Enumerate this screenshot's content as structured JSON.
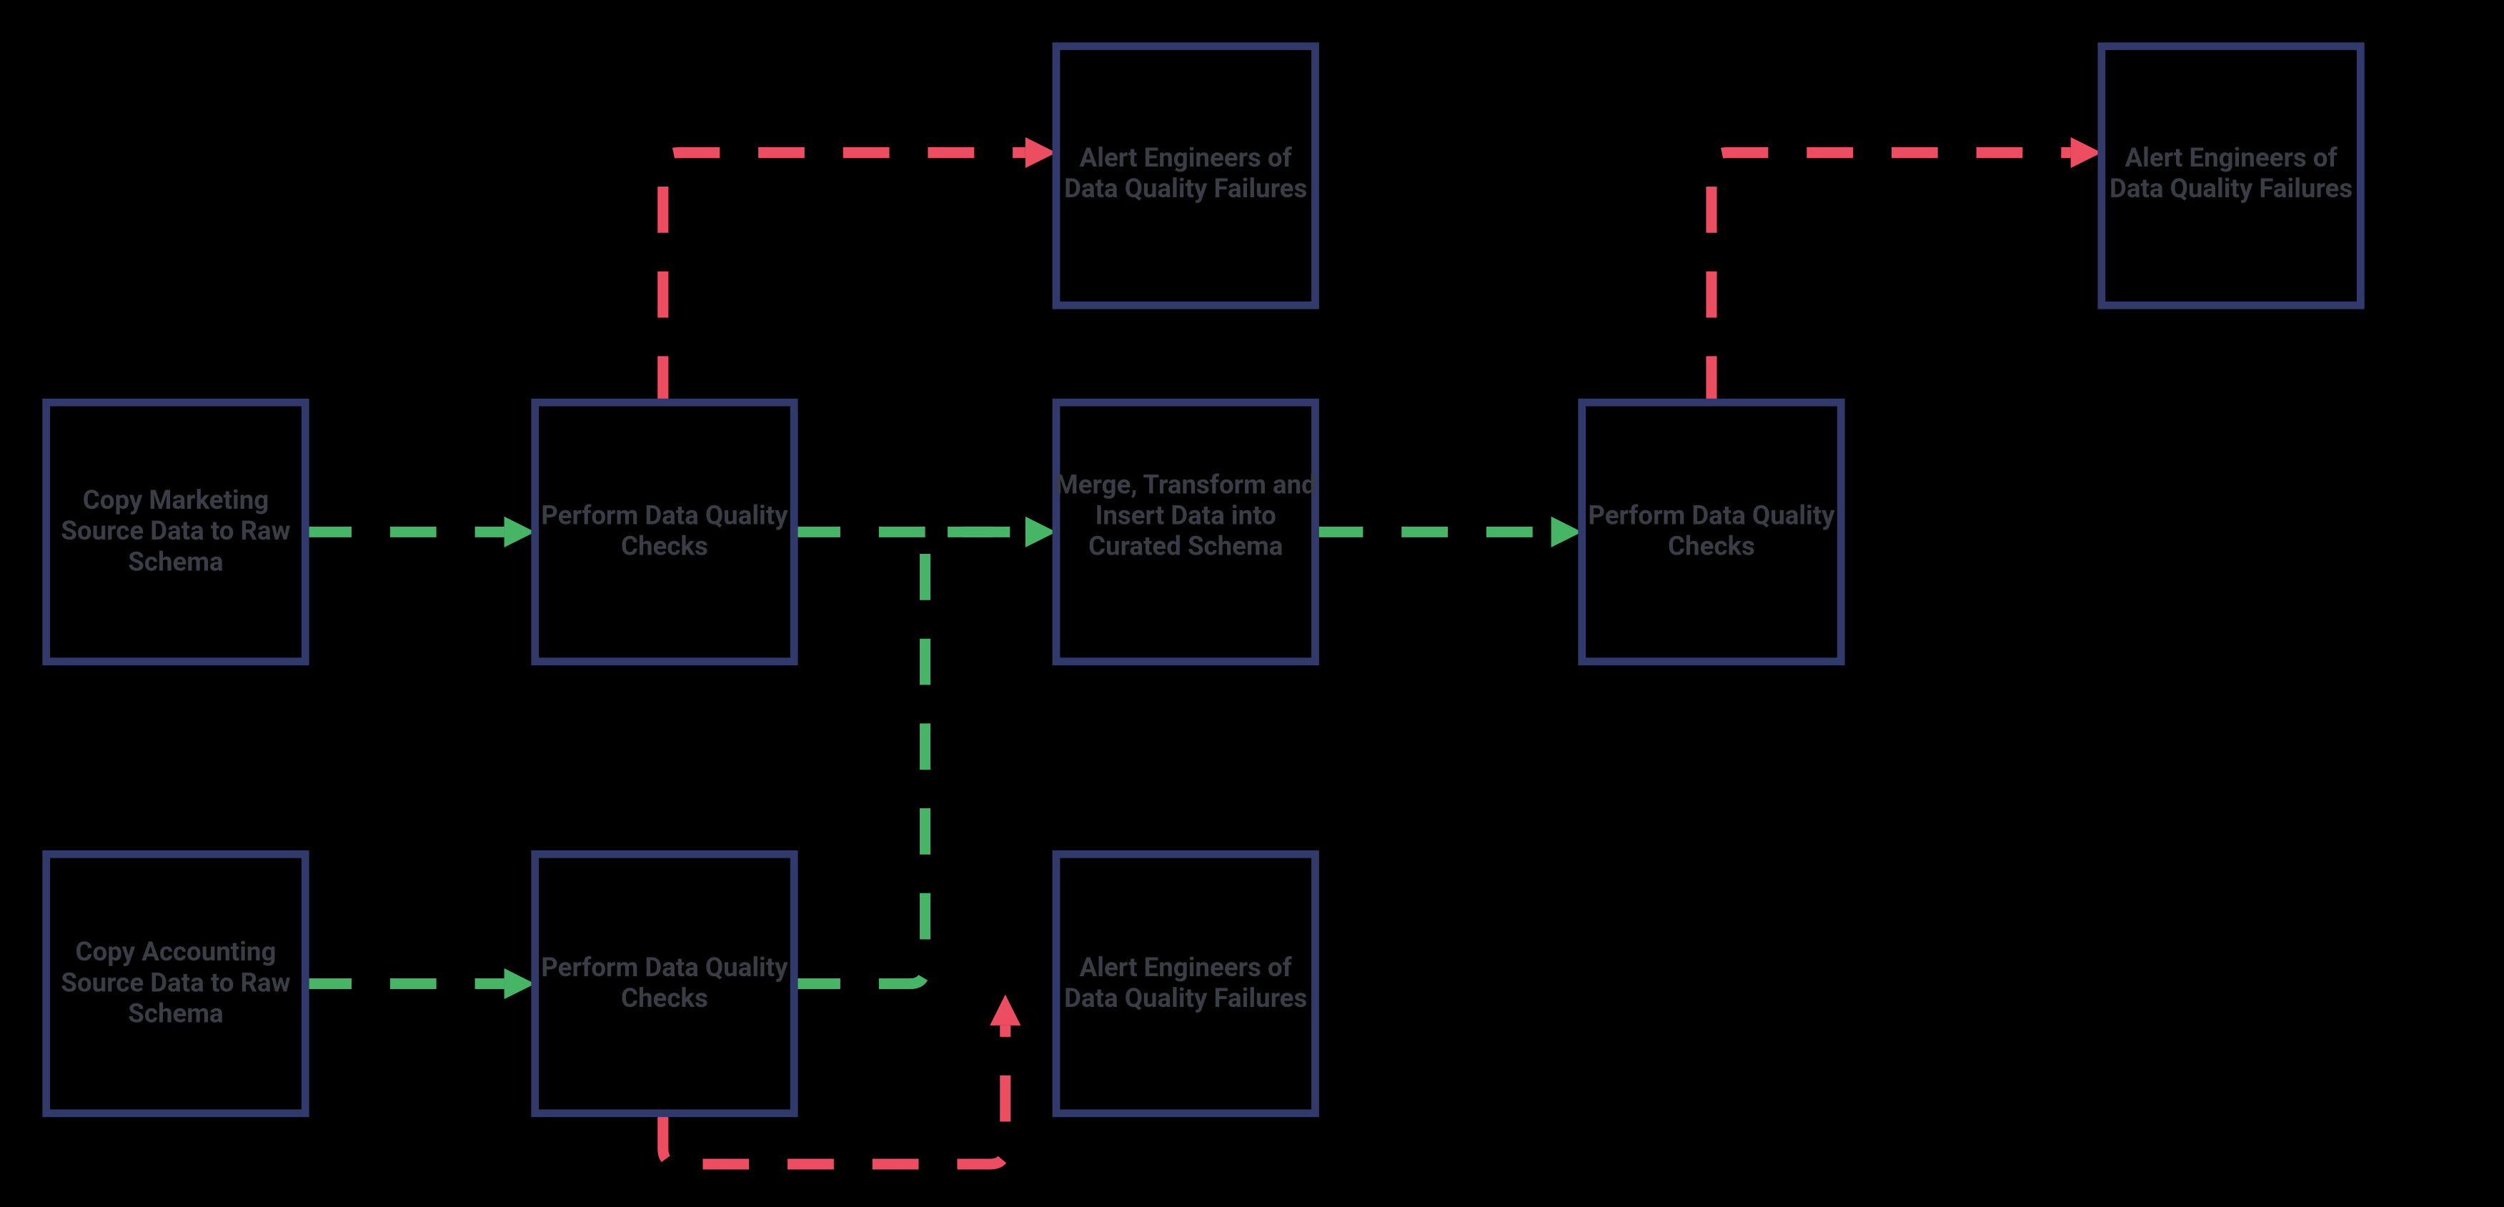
{
  "colors": {
    "background": "#000000",
    "node_border": "#313A6B",
    "node_text": "#3A3C46",
    "edge_success": "#46B565",
    "edge_failure": "#ED4D60"
  },
  "diagram": {
    "nodes": [
      {
        "id": "n1",
        "lines": [
          "Copy Marketing",
          "Source Data to Raw",
          "Schema"
        ]
      },
      {
        "id": "n2",
        "lines": [
          "Copy Accounting",
          "Source Data to Raw",
          "Schema"
        ]
      },
      {
        "id": "n3",
        "lines": [
          "Perform Data Quality",
          "Checks"
        ]
      },
      {
        "id": "n4",
        "lines": [
          "Perform Data Quality",
          "Checks"
        ]
      },
      {
        "id": "n5",
        "lines": [
          "Alert Engineers of",
          "Data Quality Failures"
        ]
      },
      {
        "id": "n6",
        "lines": [
          "Merge, Transform and",
          "Insert Data into",
          "Curated Schema"
        ]
      },
      {
        "id": "n7",
        "lines": [
          "Alert Engineers of",
          "Data Quality Failures"
        ]
      },
      {
        "id": "n8",
        "lines": [
          "Perform Data Quality",
          "Checks"
        ]
      },
      {
        "id": "n9",
        "lines": [
          "Alert Engineers of",
          "Data Quality Failures"
        ]
      }
    ],
    "edges": [
      {
        "from": "n1",
        "to": "n3",
        "type": "success"
      },
      {
        "from": "n2",
        "to": "n4",
        "type": "success"
      },
      {
        "from": "n3",
        "to": "n5",
        "type": "failure"
      },
      {
        "from": "n3",
        "to": "n6",
        "type": "success"
      },
      {
        "from": "n4",
        "to": "n6",
        "type": "success"
      },
      {
        "from": "n4",
        "to": "n7",
        "type": "failure"
      },
      {
        "from": "n6",
        "to": "n8",
        "type": "success"
      },
      {
        "from": "n8",
        "to": "n9",
        "type": "failure"
      }
    ]
  }
}
